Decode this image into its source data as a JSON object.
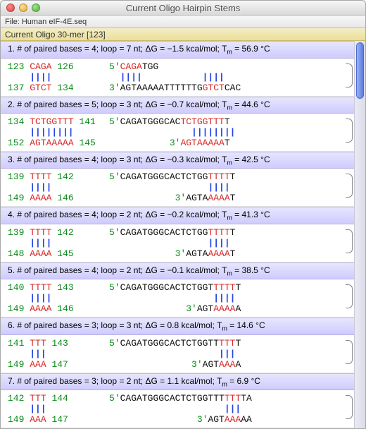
{
  "window": {
    "title": "Current Oligo Hairpin Stems"
  },
  "filebar": {
    "label": "File: Human eIF-4E.seq"
  },
  "oligobar": {
    "label": "Current Oligo 30-mer [123]"
  },
  "blocks": [
    {
      "idx": "1",
      "summary": "1. # of paired bases = 4; loop = 7 nt; ΔG = −1.5 kcal/mol; Tₘ = 56.9 °C",
      "left_top_start": "123",
      "left_top_seq": "CAGA",
      "left_top_end": "126",
      "left_bot_start": "137",
      "left_bot_seq": "GTCT",
      "left_bot_end": "134",
      "right_top_label": "5'",
      "right_top_pre_red": "CAGA",
      "right_top_pre_blk": "TGG",
      "right_top_bars_offset": "               ",
      "right_bot_label": "3'",
      "right_bot_pre_blk": "AGTAAAAATTTTTTG",
      "right_bot_pre_red": "GTCT",
      "right_bot_post": "CAC",
      "loop_char": "G"
    },
    {
      "idx": "2",
      "summary": "2. # of paired bases = 5; loop = 3 nt; ΔG = −0.7 kcal/mol; Tₘ = 44.6 °C",
      "left_top_start": "134",
      "left_top_seq": "TCTGGTTT",
      "left_top_end": "141",
      "left_bot_start": "152",
      "left_bot_seq": "AGTAAAAA",
      "left_bot_end": "145",
      "right_top_label": "5'",
      "right_top_pre_blk": "CAGATGGGCAC",
      "right_top_pre_red": "TCTGGTTT",
      "right_top_post": "T",
      "right_top_bars_offset": "             ",
      "right_bot_label": "3'",
      "right_bot_pre_red": "AGTAAAAA",
      "right_bot_post": "T",
      "right_bot_indent": "           ",
      "loop_char": "T"
    },
    {
      "idx": "3",
      "summary": "3. # of paired bases = 4; loop = 3 nt; ΔG = −0.3 kcal/mol; Tₘ = 42.5 °C",
      "left_top_start": "139",
      "left_top_seq": "TTTT",
      "left_top_end": "142",
      "left_bot_start": "149",
      "left_bot_seq": "AAAA",
      "left_bot_end": "146",
      "right_top_label": "5'",
      "right_top_pre_blk": "CAGATGGGCACTCTGG",
      "right_top_pre_red": "TTTT",
      "right_top_post": "T",
      "right_top_bars_offset": "                ",
      "right_bot_label": "3'",
      "right_bot_pre_blk": "AGTA",
      "right_bot_pre_red": "AAAA",
      "right_bot_post": "T",
      "right_bot_indent": "            ",
      "loop_char": "T"
    },
    {
      "idx": "4",
      "summary": "4. # of paired bases = 4; loop = 2 nt; ΔG = −0.2 kcal/mol; Tₘ = 41.3 °C",
      "left_top_start": "139",
      "left_top_seq": "TTTT",
      "left_top_end": "142",
      "left_bot_start": "148",
      "left_bot_seq": "AAAA",
      "left_bot_end": "145",
      "right_top_label": "5'",
      "right_top_pre_blk": "CAGATGGGCACTCTGG",
      "right_top_pre_red": "TTTT",
      "right_top_post": "T",
      "right_top_bars_offset": "                ",
      "right_bot_label": "3'",
      "right_bot_pre_blk": "AGTA",
      "right_bot_pre_red": "AAAA",
      "right_bot_post": "T",
      "right_bot_indent": "            ",
      "loop_char": ""
    },
    {
      "idx": "5",
      "summary": "5. # of paired bases = 4; loop = 2 nt; ΔG = −0.1 kcal/mol; Tₘ = 38.5 °C",
      "left_top_start": "140",
      "left_top_seq": "TTTT",
      "left_top_end": "143",
      "left_bot_start": "149",
      "left_bot_seq": "AAAA",
      "left_bot_end": "146",
      "right_top_label": "5'",
      "right_top_pre_blk": "CAGATGGGCACTCTGGT",
      "right_top_pre_red": "TTTT",
      "right_top_post": "T",
      "right_top_bars_offset": "                 ",
      "right_bot_label": "3'",
      "right_bot_pre_blk": "AGT",
      "right_bot_pre_red": "AAAA",
      "right_bot_post": "A",
      "right_bot_indent": "              ",
      "loop_char": ""
    },
    {
      "idx": "6",
      "summary": "6. # of paired bases = 3; loop = 3 nt; ΔG = 0.8 kcal/mol; Tₘ = 14.6 °C",
      "left_top_start": "141",
      "left_top_seq": "TTT",
      "left_top_end": "143",
      "left_bot_start": "149",
      "left_bot_seq": "AAA",
      "left_bot_end": "147",
      "right_top_label": "5'",
      "right_top_pre_blk": "CAGATGGGCACTCTGGTT",
      "right_top_pre_red": "TTT",
      "right_top_post": "T",
      "right_top_bars_offset": "                  ",
      "right_bot_label": "3'",
      "right_bot_pre_blk": "AGT",
      "right_bot_pre_red": "AAA",
      "right_bot_post": "A",
      "right_bot_indent": "               ",
      "loop_char": "A"
    },
    {
      "idx": "7",
      "summary": "7. # of paired bases = 3; loop = 2 nt; ΔG = 1.1 kcal/mol; Tₘ = 6.9 °C",
      "left_top_start": "142",
      "left_top_seq": "TTT",
      "left_top_end": "144",
      "left_bot_start": "149",
      "left_bot_seq": "AAA",
      "left_bot_end": "147",
      "right_top_label": "5'",
      "right_top_pre_blk": "CAGATGGGCACTCTGGTTT",
      "right_top_pre_red": "TTT",
      "right_top_post": "TA",
      "right_top_bars_offset": "                   ",
      "right_bot_label": "3'",
      "right_bot_pre_blk": "AGT",
      "right_bot_pre_red": "AAA",
      "right_bot_post": "AA",
      "right_bot_indent": "                ",
      "loop_char": ""
    }
  ]
}
